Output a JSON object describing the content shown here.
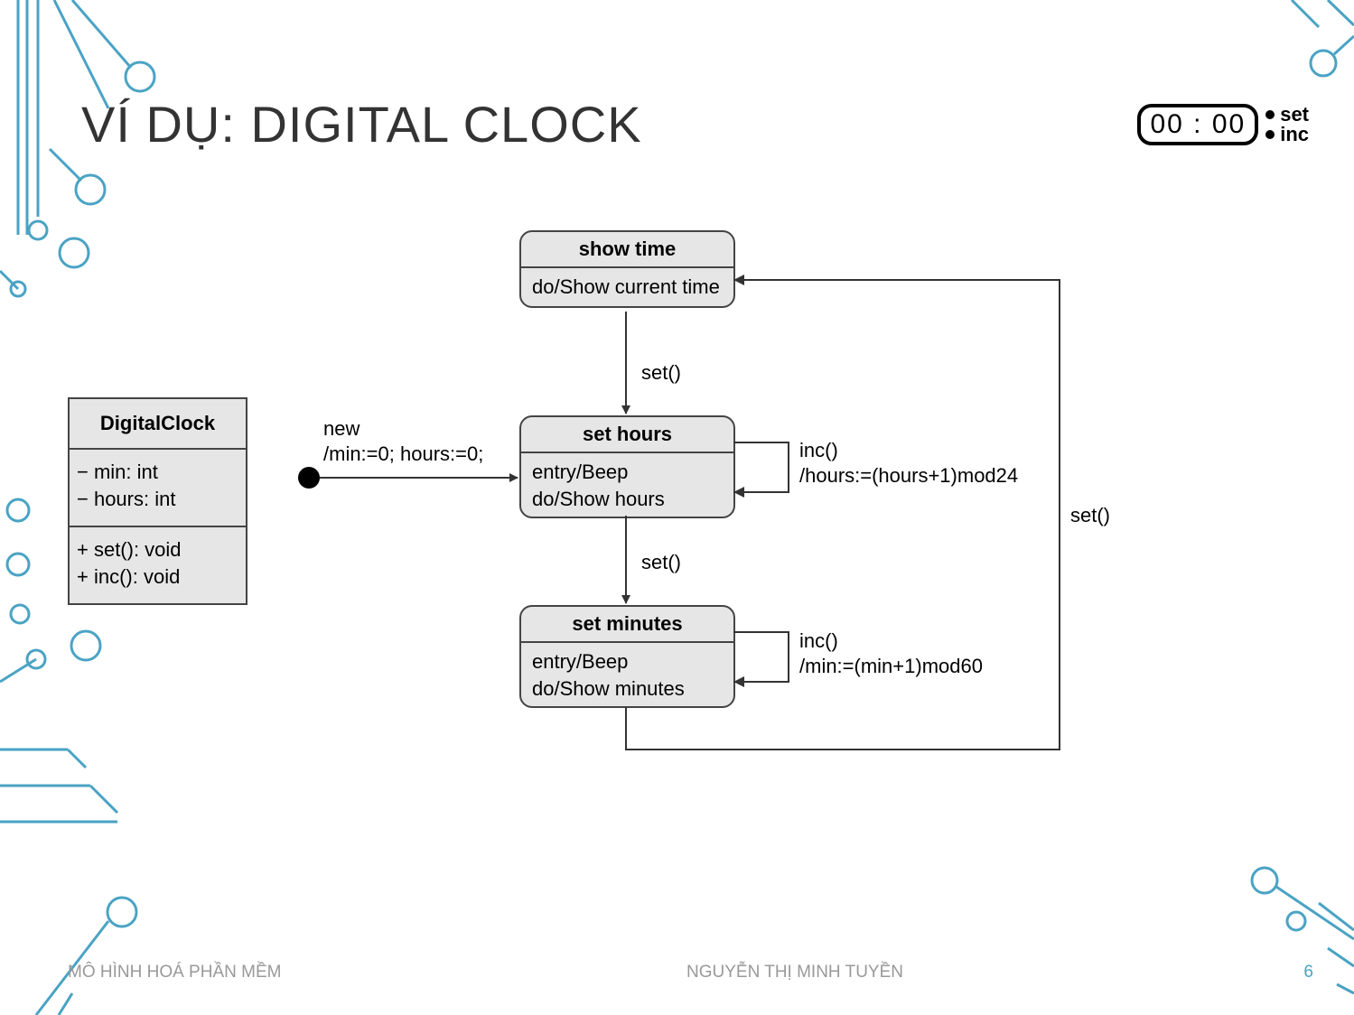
{
  "title": "VÍ DỤ: DIGITAL CLOCK",
  "clock": {
    "display": "00 : 00",
    "btn_set": "set",
    "btn_inc": "inc"
  },
  "uml": {
    "name": "DigitalClock",
    "attr1": "− min: int",
    "attr2": "− hours: int",
    "op1": "+ set(): void",
    "op2": "+ inc(): void"
  },
  "states": {
    "s1": {
      "name": "show time",
      "body": "do/Show current time"
    },
    "s2": {
      "name": "set hours",
      "body1": "entry/Beep",
      "body2": "do/Show hours"
    },
    "s3": {
      "name": "set minutes",
      "body1": "entry/Beep",
      "body2": "do/Show minutes"
    }
  },
  "transitions": {
    "init1": "new",
    "init2": "/min:=0; hours:=0;",
    "t_s1_s2": "set()",
    "t_s2_s3": "set()",
    "t_s3_s1": "set()",
    "t_s2_self_1": "inc()",
    "t_s2_self_2": "/hours:=(hours+1)mod24",
    "t_s3_self_1": "inc()",
    "t_s3_self_2": "/min:=(min+1)mod60"
  },
  "footer": {
    "left": "MÔ HÌNH HOÁ PHẦN MỀM",
    "right": "NGUYỄN THỊ MINH TUYỀN",
    "page": "6"
  },
  "decor": {
    "stroke": "#4aa3c4"
  }
}
